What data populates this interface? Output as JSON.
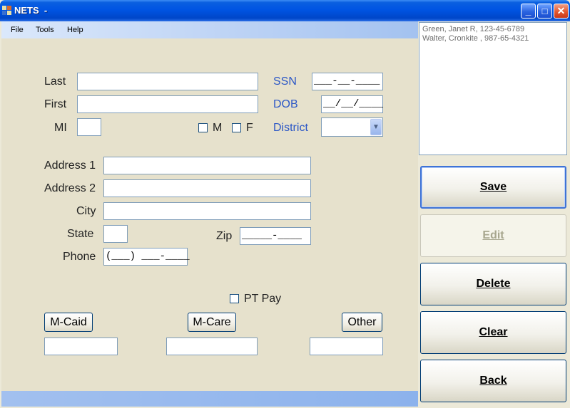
{
  "window": {
    "title": "NETS  -",
    "controls": {
      "minimize": "_",
      "maximize": "□",
      "close": "✕"
    }
  },
  "menu": {
    "file": "File",
    "tools": "Tools",
    "help": "Help"
  },
  "form": {
    "last_label": "Last",
    "first_label": "First",
    "mi_label": "MI",
    "male_label": "M",
    "female_label": "F",
    "ssn_label": "SSN",
    "ssn_mask": "___-__-____",
    "dob_label": "DOB",
    "dob_mask": "__/__/____",
    "district_label": "District",
    "address1_label": "Address 1",
    "address2_label": "Address 2",
    "city_label": "City",
    "state_label": "State",
    "zip_label": "Zip",
    "zip_mask": "_____-____",
    "phone_label": "Phone",
    "phone_mask": "(___) ___-____",
    "ptpay_label": "PT Pay",
    "mcaid_button": "M-Caid",
    "mcare_button": "M-Care",
    "other_button": "Other"
  },
  "people_list": [
    "Green, Janet R, 123-45-6789",
    "Walter, Cronkite , 987-65-4321"
  ],
  "actions": {
    "save": "Save",
    "edit": "Edit",
    "delete": "Delete",
    "clear": "Clear",
    "back": "Back"
  }
}
